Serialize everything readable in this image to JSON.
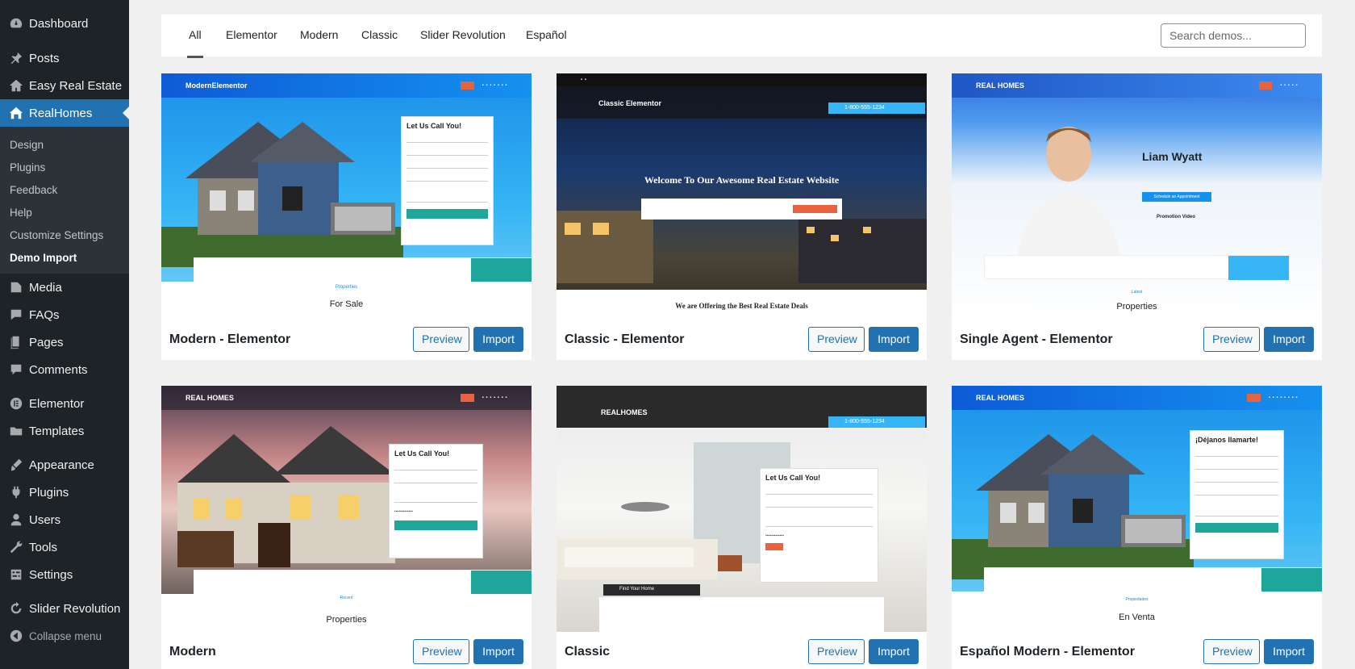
{
  "sidebar": {
    "items": [
      {
        "label": "Dashboard",
        "icon": "dashboard-icon"
      },
      {
        "label": "Posts",
        "icon": "pin-icon"
      },
      {
        "label": "Easy Real Estate",
        "icon": "house-icon"
      },
      {
        "label": "RealHomes",
        "icon": "realhomes-icon"
      }
    ],
    "submenu": [
      "Design",
      "Plugins",
      "Feedback",
      "Help",
      "Customize Settings",
      "Demo Import"
    ],
    "items2": [
      {
        "label": "Media",
        "icon": "media-icon"
      },
      {
        "label": "FAQs",
        "icon": "faqs-icon"
      },
      {
        "label": "Pages",
        "icon": "pages-icon"
      },
      {
        "label": "Comments",
        "icon": "comment-icon"
      },
      {
        "label": "Elementor",
        "icon": "elementor-icon"
      },
      {
        "label": "Templates",
        "icon": "folder-icon"
      },
      {
        "label": "Appearance",
        "icon": "brush-icon"
      },
      {
        "label": "Plugins",
        "icon": "plug-icon"
      },
      {
        "label": "Users",
        "icon": "user-icon"
      },
      {
        "label": "Tools",
        "icon": "wrench-icon"
      },
      {
        "label": "Settings",
        "icon": "settings-icon"
      },
      {
        "label": "Slider Revolution",
        "icon": "refresh-icon"
      }
    ],
    "collapse_label": "Collapse menu"
  },
  "filters": {
    "tabs": [
      "All",
      "Elementor",
      "Modern",
      "Classic",
      "Slider Revolution",
      "Español"
    ],
    "active": "All",
    "search_placeholder": "Search demos..."
  },
  "buttons": {
    "preview": "Preview",
    "import": "Import"
  },
  "demos": [
    {
      "title": "Modern - Elementor",
      "logo": "ModernElementor",
      "form_title": "Let Us Call You!",
      "section": "For Sale",
      "section_tag": "Properties"
    },
    {
      "title": "Classic - Elementor",
      "logo": "Classic Elementor",
      "hero": "Welcome To Our Awesome Real Estate Website",
      "phone": "1-800-555-1234",
      "section": "We are Offering the Best Real Estate Deals"
    },
    {
      "title": "Single Agent - Elementor",
      "logo": "REAL HOMES",
      "agent": "Liam Wyatt",
      "cta": "Schedule an Appointment",
      "video": "Promotion Video",
      "section": "Properties",
      "section_tag": "Latest"
    },
    {
      "title": "Modern",
      "logo": "REAL HOMES",
      "form_title": "Let Us Call You!",
      "section": "Properties",
      "section_tag": "Recent"
    },
    {
      "title": "Classic",
      "logo": "REALHOMES",
      "form_title": "Let Us Call You!",
      "phone": "1-800-555-1234",
      "find": "Find Your Home"
    },
    {
      "title": "Español Modern - Elementor",
      "logo": "REAL HOMES",
      "form_title": "¡Déjanos llamarte!",
      "section": "En Venta",
      "section_tag": "Propiedades"
    }
  ],
  "colors": {
    "sidebar_bg": "#1d2327",
    "accent": "#2271b1",
    "orange": "#e8623d",
    "teal": "#1ea69a"
  }
}
